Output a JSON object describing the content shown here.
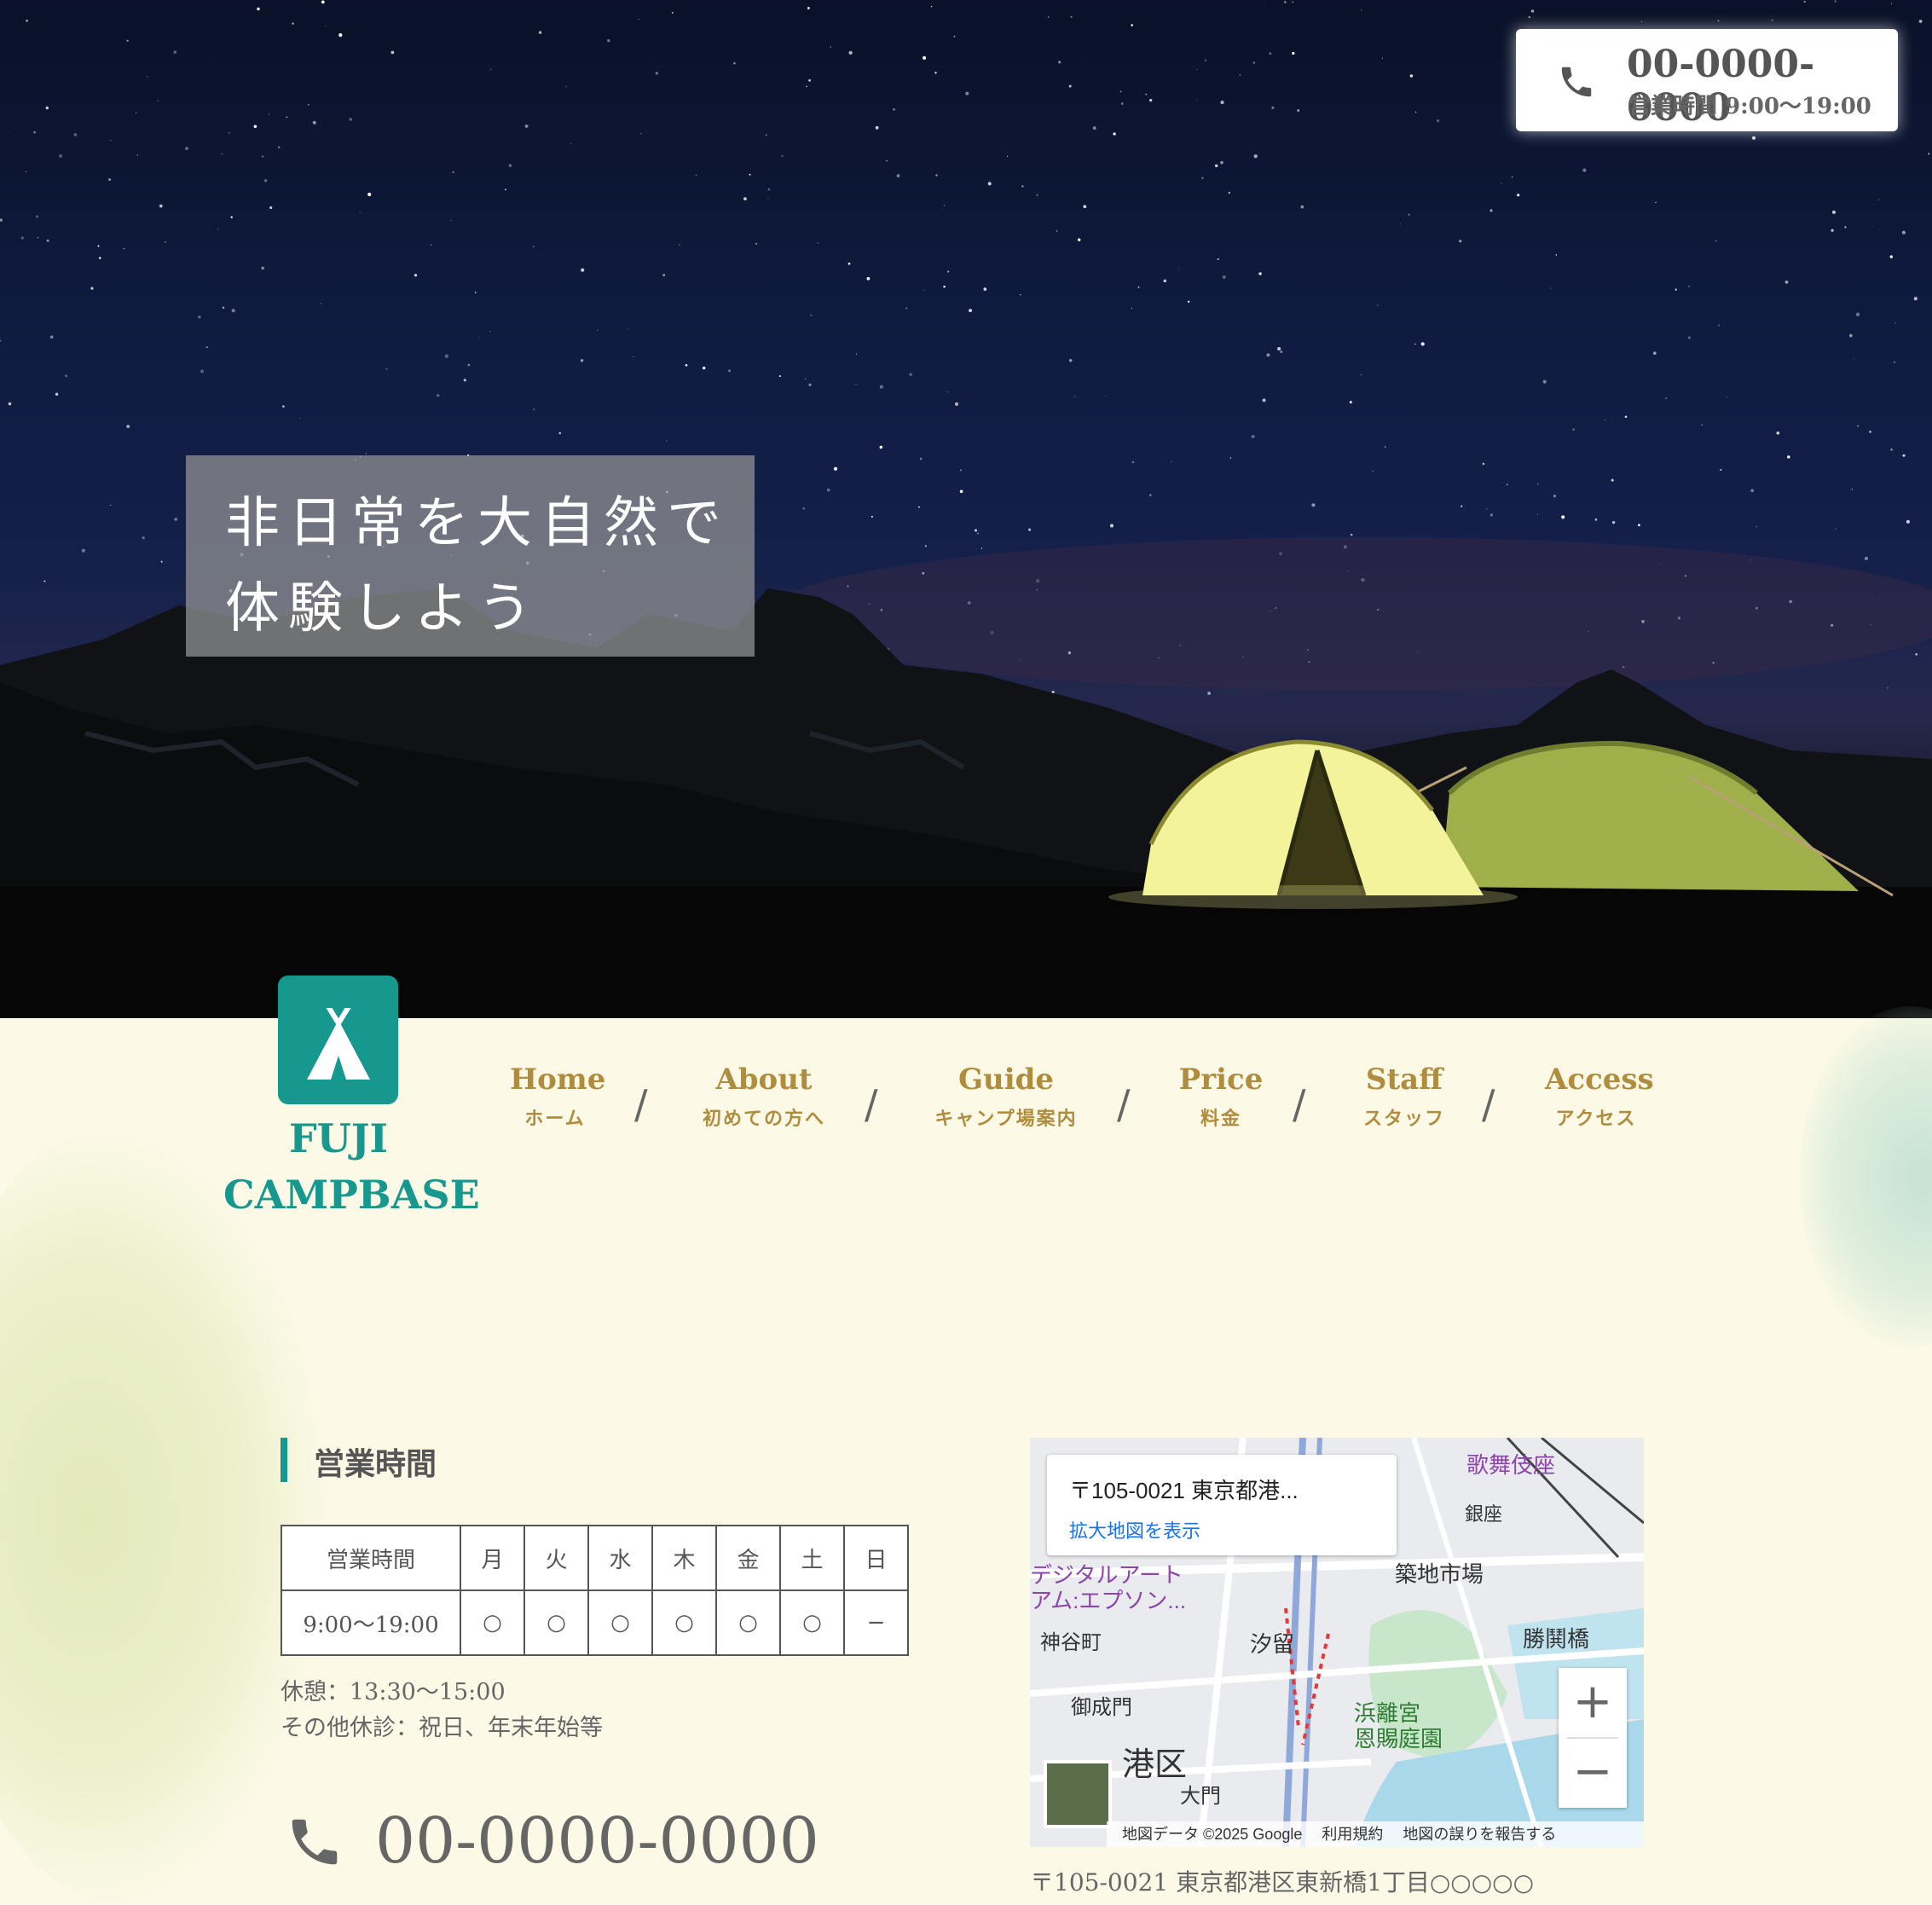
{
  "hero": {
    "phone_number": "00-0000-0000",
    "phone_hours": "営業時間 9:00〜19:00",
    "catch_line1": "非日常を大自然で",
    "catch_line2": "体験しよう"
  },
  "logo": {
    "line1": "FUJI",
    "line2": "CAMPBASE",
    "icon": "tent-icon",
    "color": "#16988e"
  },
  "nav": {
    "items": [
      {
        "en": "Home",
        "ja": "ホーム"
      },
      {
        "en": "About",
        "ja": "初めての方へ"
      },
      {
        "en": "Guide",
        "ja": "キャンプ場案内"
      },
      {
        "en": "Price",
        "ja": "料金"
      },
      {
        "en": "Staff",
        "ja": "スタッフ"
      },
      {
        "en": "Access",
        "ja": "アクセス"
      }
    ],
    "separator": "/",
    "color": "#b08d3e"
  },
  "hours": {
    "title": "営業時間",
    "header": [
      "営業時間",
      "月",
      "火",
      "水",
      "木",
      "金",
      "土",
      "日"
    ],
    "row": [
      "9:00〜19:00",
      "○",
      "○",
      "○",
      "○",
      "○",
      "○",
      "−"
    ],
    "break_note": "休憩：13:30〜15:00",
    "holiday_note": "その他休診：祝日、年末年始等",
    "phone": "00-0000-0000"
  },
  "map": {
    "card_title": "〒105-0021 東京都港...",
    "card_link": "拡大地図を表示",
    "labels": {
      "ginza": "銀座",
      "tsukiji": "築地市場",
      "shiodome": "汐留",
      "kamiyacho": "神谷町",
      "onarimon": "御成門",
      "minato": "港区",
      "daimon": "大門",
      "hamarikyu": "浜離宮\n恩賜庭園",
      "kachidoki": "勝鬨橋",
      "digital_art": "デジタルアート\nアム:エプソン..."
    },
    "footer": [
      "地図データ ©2025 Google",
      "利用規約",
      "地図の誤りを報告する"
    ],
    "zoom_in": "+",
    "zoom_out": "−",
    "address": "〒105-0021 東京都港区東新橋1丁目○○○○○"
  }
}
